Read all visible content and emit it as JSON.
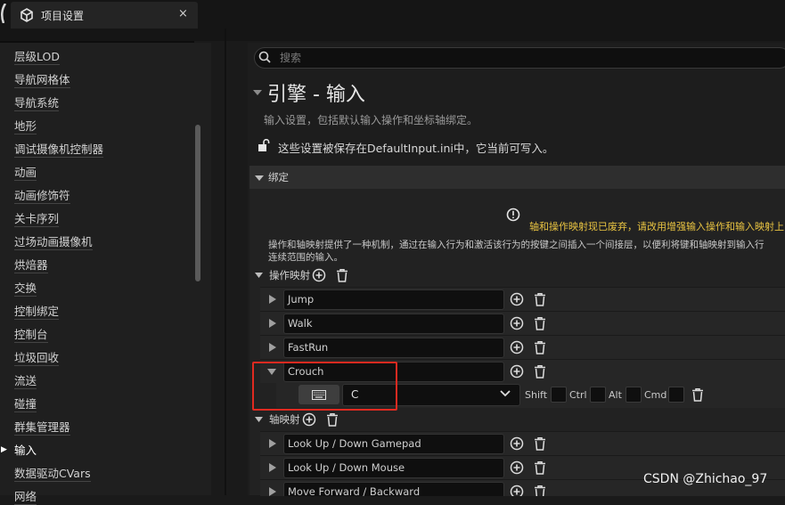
{
  "window": {
    "tab_title": "项目设置",
    "close_glyph": "×"
  },
  "sidebar": {
    "items": [
      "层级LOD",
      "导航网格体",
      "导航系统",
      "地形",
      "调试摄像机控制器",
      "动画",
      "动画修饰符",
      "关卡序列",
      "过场动画摄像机",
      "烘焙器",
      "交换",
      "控制绑定",
      "控制台",
      "垃圾回收",
      "流送",
      "碰撞",
      "群集管理器",
      "输入",
      "数据驱动CVars",
      "网络"
    ],
    "selected": "输入"
  },
  "main": {
    "search_placeholder": "搜索",
    "title": "引擎 - 输入",
    "description": "输入设置，包括默认输入操作和坐标轴绑定。",
    "config_note": "这些设置被保存在DefaultInput.ini中，它当前可写入。",
    "bindings_header": "绑定",
    "warning": "轴和操作映射现已废弃，请改用增强输入操作和输入映射上",
    "info_line1": "操作和轴映射提供了一种机制，通过在输入行为和激活该行为的按键之间插入一个间接层，以便利将键和轴映射到输入行",
    "info_line2": "连续范围的输入。",
    "action_mappings": {
      "label": "操作映射",
      "items": [
        "Jump",
        "Walk",
        "FastRun",
        "Crouch"
      ]
    },
    "crouch_key": {
      "key": "C",
      "modifiers": [
        "Shift",
        "Ctrl",
        "Alt",
        "Cmd"
      ]
    },
    "axis_mappings": {
      "label": "轴映射",
      "items": [
        "Look Up / Down Gamepad",
        "Look Up / Down Mouse",
        "Move Forward / Backward"
      ]
    }
  },
  "watermark": "CSDN @Zhichao_97",
  "colors": {
    "warning": "#e8c341",
    "highlight": "#e02a20"
  },
  "icons": [
    "project-settings-icon",
    "close-icon",
    "search-icon",
    "unlock-icon",
    "warning-icon",
    "add-icon",
    "trash-icon",
    "keyboard-icon",
    "chevron-down-icon"
  ]
}
